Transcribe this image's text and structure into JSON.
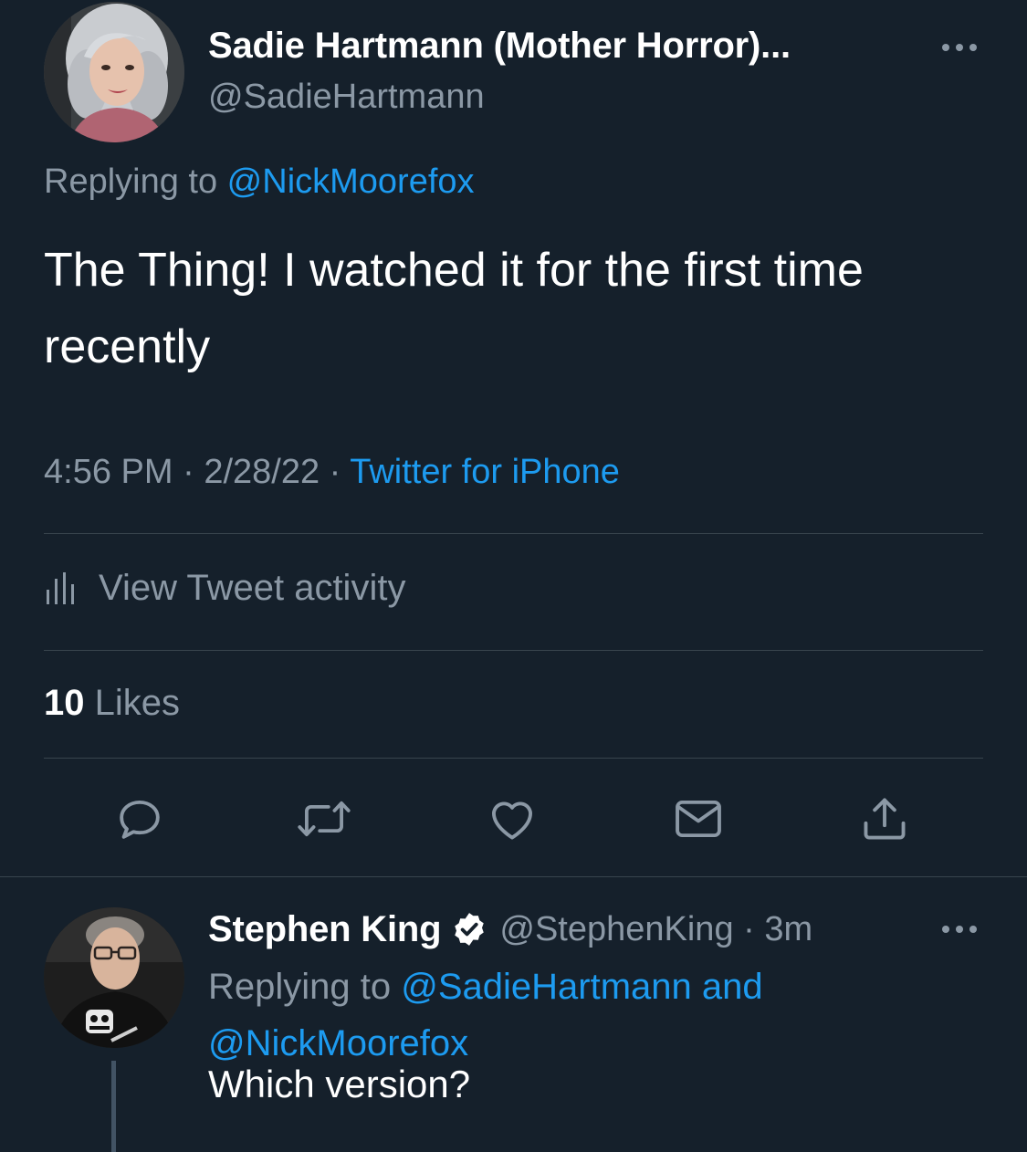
{
  "colors": {
    "background": "#15202b",
    "text_primary": "#ffffff",
    "text_secondary": "#8b98a5",
    "link": "#1d9bf0",
    "divider": "#38444d"
  },
  "main_tweet": {
    "display_name": "Sadie Hartmann (Mother Horror)...",
    "handle": "@SadieHartmann",
    "replying_prefix": "Replying to ",
    "replying_handle": "@NickMoorefox",
    "text": "The Thing! I watched it for the first time recently",
    "time": "4:56 PM",
    "separator": " · ",
    "date": "2/28/22",
    "source": "Twitter for iPhone",
    "activity_label": "View Tweet activity",
    "likes_count": "10",
    "likes_label": " Likes",
    "actions": [
      "reply-icon",
      "retweet-icon",
      "like-icon",
      "message-icon",
      "share-icon"
    ]
  },
  "reply_tweet": {
    "display_name": "Stephen King",
    "handle_time": "@StephenKing · 3m",
    "replying_prefix": "Replying to ",
    "replying_handle_1": "@SadieHartmann",
    "replying_and": " and",
    "replying_handle_2": "@NickMoorefox",
    "text": "Which version?"
  }
}
